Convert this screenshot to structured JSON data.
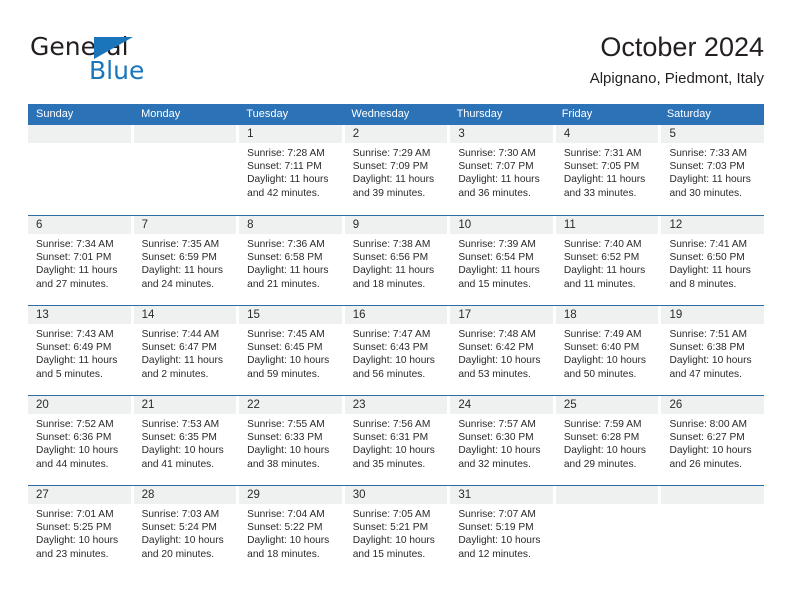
{
  "brand": {
    "name_top": "General",
    "name_bottom": "Blue",
    "accent_color": "#1b75bb",
    "flag_icon": "triangle-flag-icon"
  },
  "header": {
    "title": "October 2024",
    "subtitle": "Alpignano, Piedmont, Italy"
  },
  "colors": {
    "header_blue": "#2b72b7",
    "row_divider": "#2e6da4",
    "day_band_gray": "#eff0f0",
    "text": "#2a2a2a"
  },
  "weekdays": [
    "Sunday",
    "Monday",
    "Tuesday",
    "Wednesday",
    "Thursday",
    "Friday",
    "Saturday"
  ],
  "weeks": [
    [
      {
        "day": "",
        "lines": []
      },
      {
        "day": "",
        "lines": []
      },
      {
        "day": "1",
        "lines": [
          "Sunrise: 7:28 AM",
          "Sunset: 7:11 PM",
          "Daylight: 11 hours",
          "and 42 minutes."
        ]
      },
      {
        "day": "2",
        "lines": [
          "Sunrise: 7:29 AM",
          "Sunset: 7:09 PM",
          "Daylight: 11 hours",
          "and 39 minutes."
        ]
      },
      {
        "day": "3",
        "lines": [
          "Sunrise: 7:30 AM",
          "Sunset: 7:07 PM",
          "Daylight: 11 hours",
          "and 36 minutes."
        ]
      },
      {
        "day": "4",
        "lines": [
          "Sunrise: 7:31 AM",
          "Sunset: 7:05 PM",
          "Daylight: 11 hours",
          "and 33 minutes."
        ]
      },
      {
        "day": "5",
        "lines": [
          "Sunrise: 7:33 AM",
          "Sunset: 7:03 PM",
          "Daylight: 11 hours",
          "and 30 minutes."
        ]
      }
    ],
    [
      {
        "day": "6",
        "lines": [
          "Sunrise: 7:34 AM",
          "Sunset: 7:01 PM",
          "Daylight: 11 hours",
          "and 27 minutes."
        ]
      },
      {
        "day": "7",
        "lines": [
          "Sunrise: 7:35 AM",
          "Sunset: 6:59 PM",
          "Daylight: 11 hours",
          "and 24 minutes."
        ]
      },
      {
        "day": "8",
        "lines": [
          "Sunrise: 7:36 AM",
          "Sunset: 6:58 PM",
          "Daylight: 11 hours",
          "and 21 minutes."
        ]
      },
      {
        "day": "9",
        "lines": [
          "Sunrise: 7:38 AM",
          "Sunset: 6:56 PM",
          "Daylight: 11 hours",
          "and 18 minutes."
        ]
      },
      {
        "day": "10",
        "lines": [
          "Sunrise: 7:39 AM",
          "Sunset: 6:54 PM",
          "Daylight: 11 hours",
          "and 15 minutes."
        ]
      },
      {
        "day": "11",
        "lines": [
          "Sunrise: 7:40 AM",
          "Sunset: 6:52 PM",
          "Daylight: 11 hours",
          "and 11 minutes."
        ]
      },
      {
        "day": "12",
        "lines": [
          "Sunrise: 7:41 AM",
          "Sunset: 6:50 PM",
          "Daylight: 11 hours",
          "and 8 minutes."
        ]
      }
    ],
    [
      {
        "day": "13",
        "lines": [
          "Sunrise: 7:43 AM",
          "Sunset: 6:49 PM",
          "Daylight: 11 hours",
          "and 5 minutes."
        ]
      },
      {
        "day": "14",
        "lines": [
          "Sunrise: 7:44 AM",
          "Sunset: 6:47 PM",
          "Daylight: 11 hours",
          "and 2 minutes."
        ]
      },
      {
        "day": "15",
        "lines": [
          "Sunrise: 7:45 AM",
          "Sunset: 6:45 PM",
          "Daylight: 10 hours",
          "and 59 minutes."
        ]
      },
      {
        "day": "16",
        "lines": [
          "Sunrise: 7:47 AM",
          "Sunset: 6:43 PM",
          "Daylight: 10 hours",
          "and 56 minutes."
        ]
      },
      {
        "day": "17",
        "lines": [
          "Sunrise: 7:48 AM",
          "Sunset: 6:42 PM",
          "Daylight: 10 hours",
          "and 53 minutes."
        ]
      },
      {
        "day": "18",
        "lines": [
          "Sunrise: 7:49 AM",
          "Sunset: 6:40 PM",
          "Daylight: 10 hours",
          "and 50 minutes."
        ]
      },
      {
        "day": "19",
        "lines": [
          "Sunrise: 7:51 AM",
          "Sunset: 6:38 PM",
          "Daylight: 10 hours",
          "and 47 minutes."
        ]
      }
    ],
    [
      {
        "day": "20",
        "lines": [
          "Sunrise: 7:52 AM",
          "Sunset: 6:36 PM",
          "Daylight: 10 hours",
          "and 44 minutes."
        ]
      },
      {
        "day": "21",
        "lines": [
          "Sunrise: 7:53 AM",
          "Sunset: 6:35 PM",
          "Daylight: 10 hours",
          "and 41 minutes."
        ]
      },
      {
        "day": "22",
        "lines": [
          "Sunrise: 7:55 AM",
          "Sunset: 6:33 PM",
          "Daylight: 10 hours",
          "and 38 minutes."
        ]
      },
      {
        "day": "23",
        "lines": [
          "Sunrise: 7:56 AM",
          "Sunset: 6:31 PM",
          "Daylight: 10 hours",
          "and 35 minutes."
        ]
      },
      {
        "day": "24",
        "lines": [
          "Sunrise: 7:57 AM",
          "Sunset: 6:30 PM",
          "Daylight: 10 hours",
          "and 32 minutes."
        ]
      },
      {
        "day": "25",
        "lines": [
          "Sunrise: 7:59 AM",
          "Sunset: 6:28 PM",
          "Daylight: 10 hours",
          "and 29 minutes."
        ]
      },
      {
        "day": "26",
        "lines": [
          "Sunrise: 8:00 AM",
          "Sunset: 6:27 PM",
          "Daylight: 10 hours",
          "and 26 minutes."
        ]
      }
    ],
    [
      {
        "day": "27",
        "lines": [
          "Sunrise: 7:01 AM",
          "Sunset: 5:25 PM",
          "Daylight: 10 hours",
          "and 23 minutes."
        ]
      },
      {
        "day": "28",
        "lines": [
          "Sunrise: 7:03 AM",
          "Sunset: 5:24 PM",
          "Daylight: 10 hours",
          "and 20 minutes."
        ]
      },
      {
        "day": "29",
        "lines": [
          "Sunrise: 7:04 AM",
          "Sunset: 5:22 PM",
          "Daylight: 10 hours",
          "and 18 minutes."
        ]
      },
      {
        "day": "30",
        "lines": [
          "Sunrise: 7:05 AM",
          "Sunset: 5:21 PM",
          "Daylight: 10 hours",
          "and 15 minutes."
        ]
      },
      {
        "day": "31",
        "lines": [
          "Sunrise: 7:07 AM",
          "Sunset: 5:19 PM",
          "Daylight: 10 hours",
          "and 12 minutes."
        ]
      },
      {
        "day": "",
        "lines": []
      },
      {
        "day": "",
        "lines": []
      }
    ]
  ]
}
